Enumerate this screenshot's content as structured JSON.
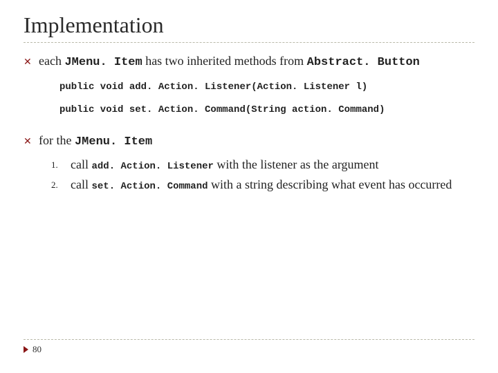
{
  "title": "Implementation",
  "bullets": [
    {
      "pre": "each ",
      "code1": "JMenu. Item",
      "mid": " has two inherited methods from ",
      "code2": "Abstract. Button"
    },
    {
      "pre": "for the ",
      "code1": "JMenu. Item",
      "mid": "",
      "code2": ""
    }
  ],
  "code_lines": [
    "public void add. Action. Listener(Action. Listener l)",
    "public void set. Action. Command(String action. Command)"
  ],
  "numbered": [
    {
      "n": "1.",
      "pre": "call ",
      "code": "add. Action. Listener",
      "post": " with the listener as the argument"
    },
    {
      "n": "2.",
      "pre": "call ",
      "code": "set. Action. Command",
      "post": " with a string describing what event has occurred"
    }
  ],
  "page": "80"
}
